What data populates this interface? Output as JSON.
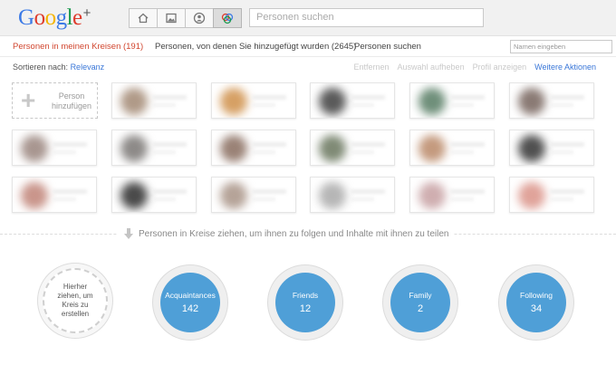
{
  "logo": {
    "g1": "G",
    "o1": "o",
    "o2": "o",
    "g2": "g",
    "l": "l",
    "e": "e",
    "plus": "+"
  },
  "search": {
    "placeholder": "Personen suchen"
  },
  "tabs": [
    {
      "label": "Personen in meinen Kreisen (191)"
    },
    {
      "label": "Personen, von denen Sie hinzugefügt wurden (2645)"
    },
    {
      "label": "Personen suchen"
    }
  ],
  "name_filter": {
    "placeholder": "Namen eingeben"
  },
  "sort": {
    "label": "Sortieren nach:",
    "value": "Relevanz"
  },
  "actions": {
    "remove": "Entfernen",
    "deselect": "Auswahl aufheben",
    "show_profile": "Profil anzeigen",
    "more": "Weitere Aktionen"
  },
  "add_person": {
    "plus": "+",
    "label": "Person hinzufügen"
  },
  "people": [
    {
      "color": "#b09a88"
    },
    {
      "color": "#d6a064"
    },
    {
      "color": "#5a5a5a"
    },
    {
      "color": "#6f8f7a"
    },
    {
      "color": "#8a7a74"
    },
    {
      "color": "#a89690"
    },
    {
      "color": "#8d8a88"
    },
    {
      "color": "#9a8276"
    },
    {
      "color": "#7f8a75"
    },
    {
      "color": "#c49a7e"
    },
    {
      "color": "#505050"
    },
    {
      "color": "#c9958b"
    },
    {
      "color": "#4a4a4a"
    },
    {
      "color": "#b5a398"
    },
    {
      "color": "#b6b6b6"
    },
    {
      "color": "#cfaeb0"
    },
    {
      "color": "#e0a39a"
    }
  ],
  "hint": {
    "text": "Personen in Kreise ziehen, um ihnen zu folgen und Inhalte mit ihnen zu teilen"
  },
  "new_circle": {
    "label": "Hierher ziehen, um Kreis zu erstellen"
  },
  "circles": [
    {
      "name": "Acquaintances",
      "count": "142"
    },
    {
      "name": "Friends",
      "count": "12"
    },
    {
      "name": "Family",
      "count": "2"
    },
    {
      "name": "Following",
      "count": "34"
    }
  ],
  "colors": {
    "accent_red": "#d1462f",
    "link_blue": "#3a77d8",
    "circle_blue": "#4f9fd7"
  }
}
